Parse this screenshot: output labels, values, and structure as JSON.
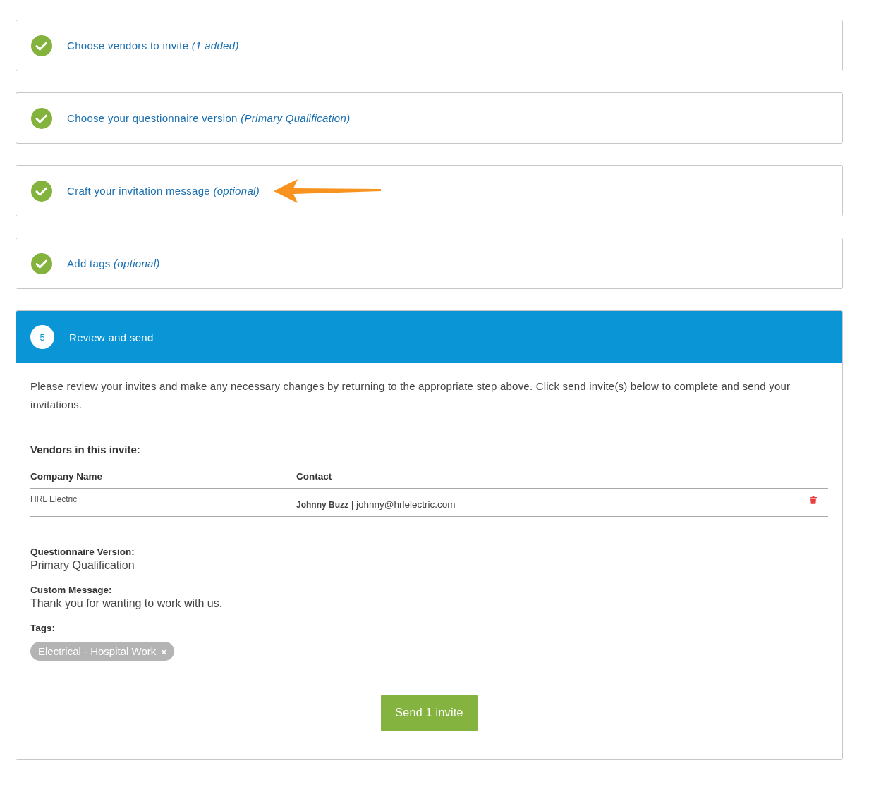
{
  "steps": [
    {
      "title": "Choose vendors to invite",
      "note": "(1 added)",
      "done": true,
      "pointed": false
    },
    {
      "title": "Choose your questionnaire version",
      "note": "(Primary Qualification)",
      "done": true,
      "pointed": false
    },
    {
      "title": "Craft your invitation message",
      "note": "(optional)",
      "done": true,
      "pointed": true
    },
    {
      "title": "Add tags",
      "note": "(optional)",
      "done": true,
      "pointed": false
    }
  ],
  "active_step": {
    "number": "5",
    "title": "Review and send"
  },
  "intro": "Please review your invites and make any necessary changes by returning to the appropriate step above. Click send invite(s) below to complete and send your invitations.",
  "vendors_heading": "Vendors in this invite:",
  "table": {
    "columns": [
      "Company Name",
      "Contact"
    ],
    "rows": [
      {
        "company": "HRL Electric",
        "contact_name": "Johnny Buzz",
        "separator": "|",
        "email": "johnny@hrlelectric.com"
      }
    ]
  },
  "details": [
    {
      "label": "Questionnaire Version:",
      "value": "Primary Qualification"
    },
    {
      "label": "Custom Message:",
      "value": "Thank you for wanting to work with us."
    }
  ],
  "tags_label": "Tags:",
  "tags": [
    {
      "label": "Electrical - Hospital Work",
      "remove": "×"
    }
  ],
  "send_button": "Send 1 invite"
}
